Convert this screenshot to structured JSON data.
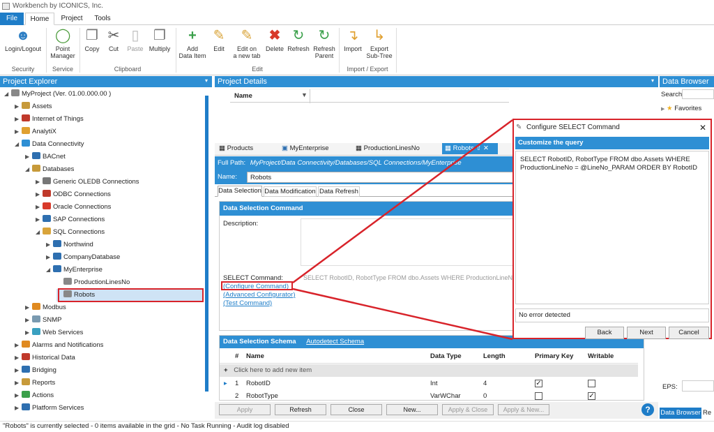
{
  "app": {
    "title": "Workbench by ICONICS, Inc."
  },
  "menu_tabs": [
    "File",
    "Home",
    "Project",
    "Tools"
  ],
  "ribbon": {
    "buttons": {
      "login": "Login/Logout",
      "point_manager": "Point\nManager",
      "copy": "Copy",
      "cut": "Cut",
      "paste": "Paste",
      "multiply": "Multiply",
      "add": "Add\nData Item",
      "edit": "Edit",
      "edit_new_tab": "Edit on\na new tab",
      "delete": "Delete",
      "refresh": "Refresh",
      "refresh_parent": "Refresh\nParent",
      "import": "Import",
      "export": "Export\nSub-Tree"
    },
    "groups": [
      "Security",
      "Service",
      "Clipboard",
      "Edit",
      "Import / Export"
    ]
  },
  "project_explorer": {
    "title": "Project Explorer",
    "items": [
      {
        "label": "MyProject (Ver. 01.00.000.00 )",
        "level": 0,
        "expand": "open",
        "icon": "project"
      },
      {
        "label": "Assets",
        "level": 1,
        "expand": "closed",
        "icon": "assets"
      },
      {
        "label": "Internet of Things",
        "level": 1,
        "expand": "closed",
        "icon": "iot"
      },
      {
        "label": "AnalytiX",
        "level": 1,
        "expand": "closed",
        "icon": "analytix"
      },
      {
        "label": "Data Connectivity",
        "level": 1,
        "expand": "open",
        "icon": "data"
      },
      {
        "label": "BACnet",
        "level": 2,
        "expand": "closed",
        "icon": "bacnet"
      },
      {
        "label": "Databases",
        "level": 2,
        "expand": "open",
        "icon": "db"
      },
      {
        "label": "Generic OLEDB Connections",
        "level": 3,
        "expand": "closed",
        "icon": "oledb"
      },
      {
        "label": "ODBC Connections",
        "level": 3,
        "expand": "closed",
        "icon": "odbc"
      },
      {
        "label": "Oracle Connections",
        "level": 3,
        "expand": "closed",
        "icon": "oracle"
      },
      {
        "label": "SAP Connections",
        "level": 3,
        "expand": "closed",
        "icon": "sap"
      },
      {
        "label": "SQL Connections",
        "level": 3,
        "expand": "open",
        "icon": "sql"
      },
      {
        "label": "Northwind",
        "level": 4,
        "expand": "closed",
        "icon": "conn"
      },
      {
        "label": "CompanyDatabase",
        "level": 4,
        "expand": "closed",
        "icon": "conn"
      },
      {
        "label": "MyEnterprise",
        "level": 4,
        "expand": "open",
        "icon": "conn"
      },
      {
        "label": "ProductionLinesNo",
        "level": 5,
        "expand": "none",
        "icon": "table"
      },
      {
        "label": "Robots",
        "level": 5,
        "expand": "none",
        "icon": "table",
        "selected": true
      },
      {
        "label": "Modbus",
        "level": 2,
        "expand": "closed",
        "icon": "modbus"
      },
      {
        "label": "SNMP",
        "level": 2,
        "expand": "closed",
        "icon": "snmp"
      },
      {
        "label": "Web Services",
        "level": 2,
        "expand": "closed",
        "icon": "web"
      },
      {
        "label": "Alarms and Notifications",
        "level": 1,
        "expand": "closed",
        "icon": "alarm"
      },
      {
        "label": "Historical Data",
        "level": 1,
        "expand": "closed",
        "icon": "hist"
      },
      {
        "label": "Bridging",
        "level": 1,
        "expand": "closed",
        "icon": "bridge"
      },
      {
        "label": "Reports",
        "level": 1,
        "expand": "closed",
        "icon": "reports"
      },
      {
        "label": "Actions",
        "level": 1,
        "expand": "closed",
        "icon": "actions"
      },
      {
        "label": "Platform Services",
        "level": 1,
        "expand": "closed",
        "icon": "platform"
      }
    ]
  },
  "project_details": {
    "title": "Project Details",
    "grid_header": "Name",
    "doc_tabs": [
      "Products",
      "MyEnterprise",
      "ProductionLinesNo",
      "Robots"
    ],
    "full_path_label": "Full Path:",
    "full_path_value": "MyProject/Data Connectivity/Databases/SQL Connections/MyEnterprise",
    "name_label": "Name:",
    "name_value": "Robots",
    "sub_tabs": [
      "Data Selection",
      "Data Modification",
      "Data Refresh"
    ],
    "section_title": "Data Selection Command",
    "description_label": "Description:",
    "select_label": "SELECT Command:",
    "select_value": "SELECT RobotID, RobotType FROM dbo.Assets WHERE ProductionLineNo",
    "links": [
      "(Configure Command)",
      "(Advanced Configurator)",
      "(Test Command)"
    ],
    "schema_title": "Data Selection Schema",
    "schema_link": "Autodetect Schema",
    "schema_columns": [
      "#",
      "Name",
      "Data Type",
      "Length",
      "Primary Key",
      "Writable"
    ],
    "add_row_text": "Click here to add new item",
    "schema_rows": [
      {
        "num": "1",
        "name": "RobotID",
        "type": "Int",
        "length": "4",
        "pk": true,
        "writable": false
      },
      {
        "num": "2",
        "name": "RobotType",
        "type": "VarWChar",
        "length": "0",
        "pk": false,
        "writable": true
      }
    ],
    "buttons": [
      "Apply",
      "Refresh",
      "Close",
      "New...",
      "Apply & Close",
      "Apply & New..."
    ]
  },
  "dialog": {
    "title": "Configure SELECT Command",
    "header": "Customize the query",
    "query": "SELECT RobotID, RobotType FROM dbo.Assets WHERE ProductionLineNo = @LineNo_PARAM ORDER BY RobotID",
    "status": "No error detected",
    "buttons": [
      "Back",
      "Next",
      "Cancel"
    ]
  },
  "data_browser": {
    "title": "Data Browser",
    "search_label": "Search:",
    "favorites": "Favorites",
    "eps_label": "EPS:",
    "bottom_tabs": [
      "Data Browser",
      "Re"
    ]
  },
  "status_bar": "\"Robots\" is currently selected - 0 items available in the grid - No Task Running - Audit log disabled",
  "colors": {
    "accent": "#1e7dc8",
    "header": "#2e8fd4",
    "highlight": "#d8232a"
  }
}
